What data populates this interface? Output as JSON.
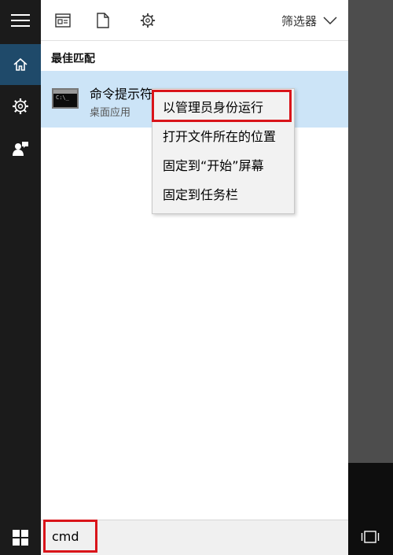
{
  "sidebar": {
    "items": [
      {
        "icon": "hamburger-menu-icon"
      },
      {
        "icon": "home-icon",
        "active": true
      },
      {
        "icon": "settings-gear-icon"
      },
      {
        "icon": "user-feedback-icon"
      }
    ]
  },
  "toolbar": {
    "icons": [
      "document-window-icon",
      "blank-document-icon",
      "settings-gear-icon"
    ],
    "filter_label": "筛选器"
  },
  "results": {
    "section_title": "最佳匹配",
    "items": [
      {
        "name": "命令提示符",
        "type": "桌面应用",
        "icon": "command-prompt-icon"
      }
    ]
  },
  "context_menu": {
    "items": [
      {
        "label": "以管理员身份运行",
        "highlighted": true
      },
      {
        "label": "打开文件所在的位置"
      },
      {
        "label": "固定到“开始”屏幕"
      },
      {
        "label": "固定到任务栏"
      }
    ]
  },
  "search": {
    "value": "cmd"
  },
  "colors": {
    "rail": "#1b1b1b",
    "active_rail": "#1f4a6a",
    "selected_row": "#cce4f7",
    "highlight_red": "#d9141a",
    "backdrop": "#4d4d4d"
  }
}
